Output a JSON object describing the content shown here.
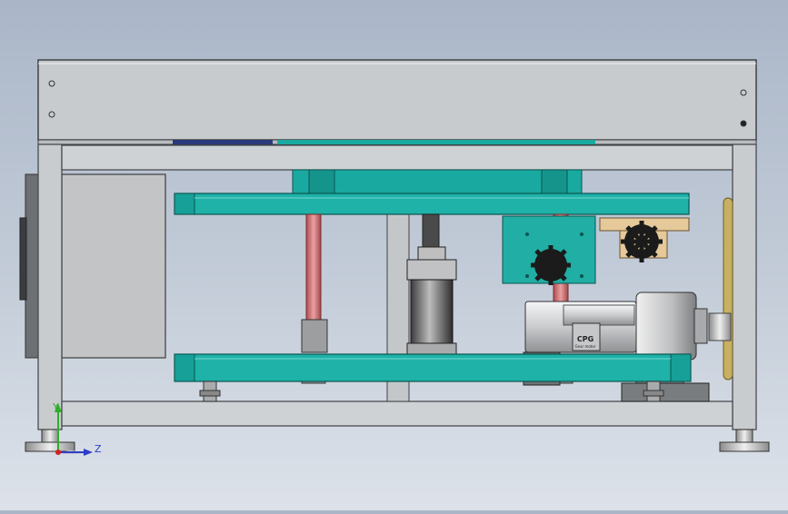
{
  "viewport": {
    "background_top": "#aab6c8",
    "background_bottom": "#dde2ea"
  },
  "colors": {
    "frame": "#c9cccf",
    "frame_edge": "#4a4d52",
    "teal": "#19a9a0",
    "teal_dark": "#0c6f69",
    "rod": "#d9787a",
    "motor": "#e2e4e6",
    "gear": "#1b1b1b",
    "bracket": "#e6c99a",
    "axis_x": "#2e3cc7",
    "axis_y": "#2bb02b",
    "axis_origin": "#d42020"
  },
  "motor": {
    "brand_label": "CPG",
    "sub_label": "Gear motor"
  },
  "triad": {
    "axes": [
      {
        "name": "Y",
        "icon": "y-axis-arrow-icon"
      },
      {
        "name": "Z",
        "icon": "z-axis-arrow-icon"
      }
    ]
  }
}
